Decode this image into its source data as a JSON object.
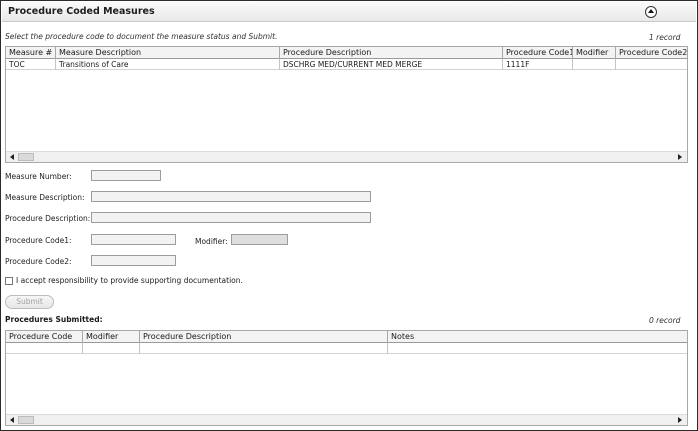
{
  "panel": {
    "title": "Procedure Coded Measures",
    "collapse_icon": "chevron-up-circle"
  },
  "instruction": "Select the procedure code to document the measure status and Submit.",
  "measures_grid": {
    "record_count": "1 record",
    "columns": [
      "Measure #",
      "Measure Description",
      "Procedure Description",
      "Procedure Code1",
      "Modifier",
      "Procedure Code2"
    ],
    "rows": [
      [
        "TOC",
        "Transitions of Care",
        "DSCHRG MED/CURRENT MED MERGE",
        "1111F",
        "",
        ""
      ]
    ]
  },
  "form": {
    "measure_number_label": "Measure Number:",
    "measure_description_label": "Measure Description:",
    "procedure_description_label": "Procedure Description:",
    "procedure_code1_label": "Procedure Code1:",
    "modifier_label": "Modifier:",
    "procedure_code2_label": "Procedure Code2:",
    "accept_label": "I accept responsibility to provide supporting documentation.",
    "submit_label": "Submit"
  },
  "submitted": {
    "label": "Procedures Submitted:",
    "record_count": "0 record",
    "columns": [
      "Procedure Code",
      "Modifier",
      "Procedure Description",
      "Notes"
    ]
  }
}
